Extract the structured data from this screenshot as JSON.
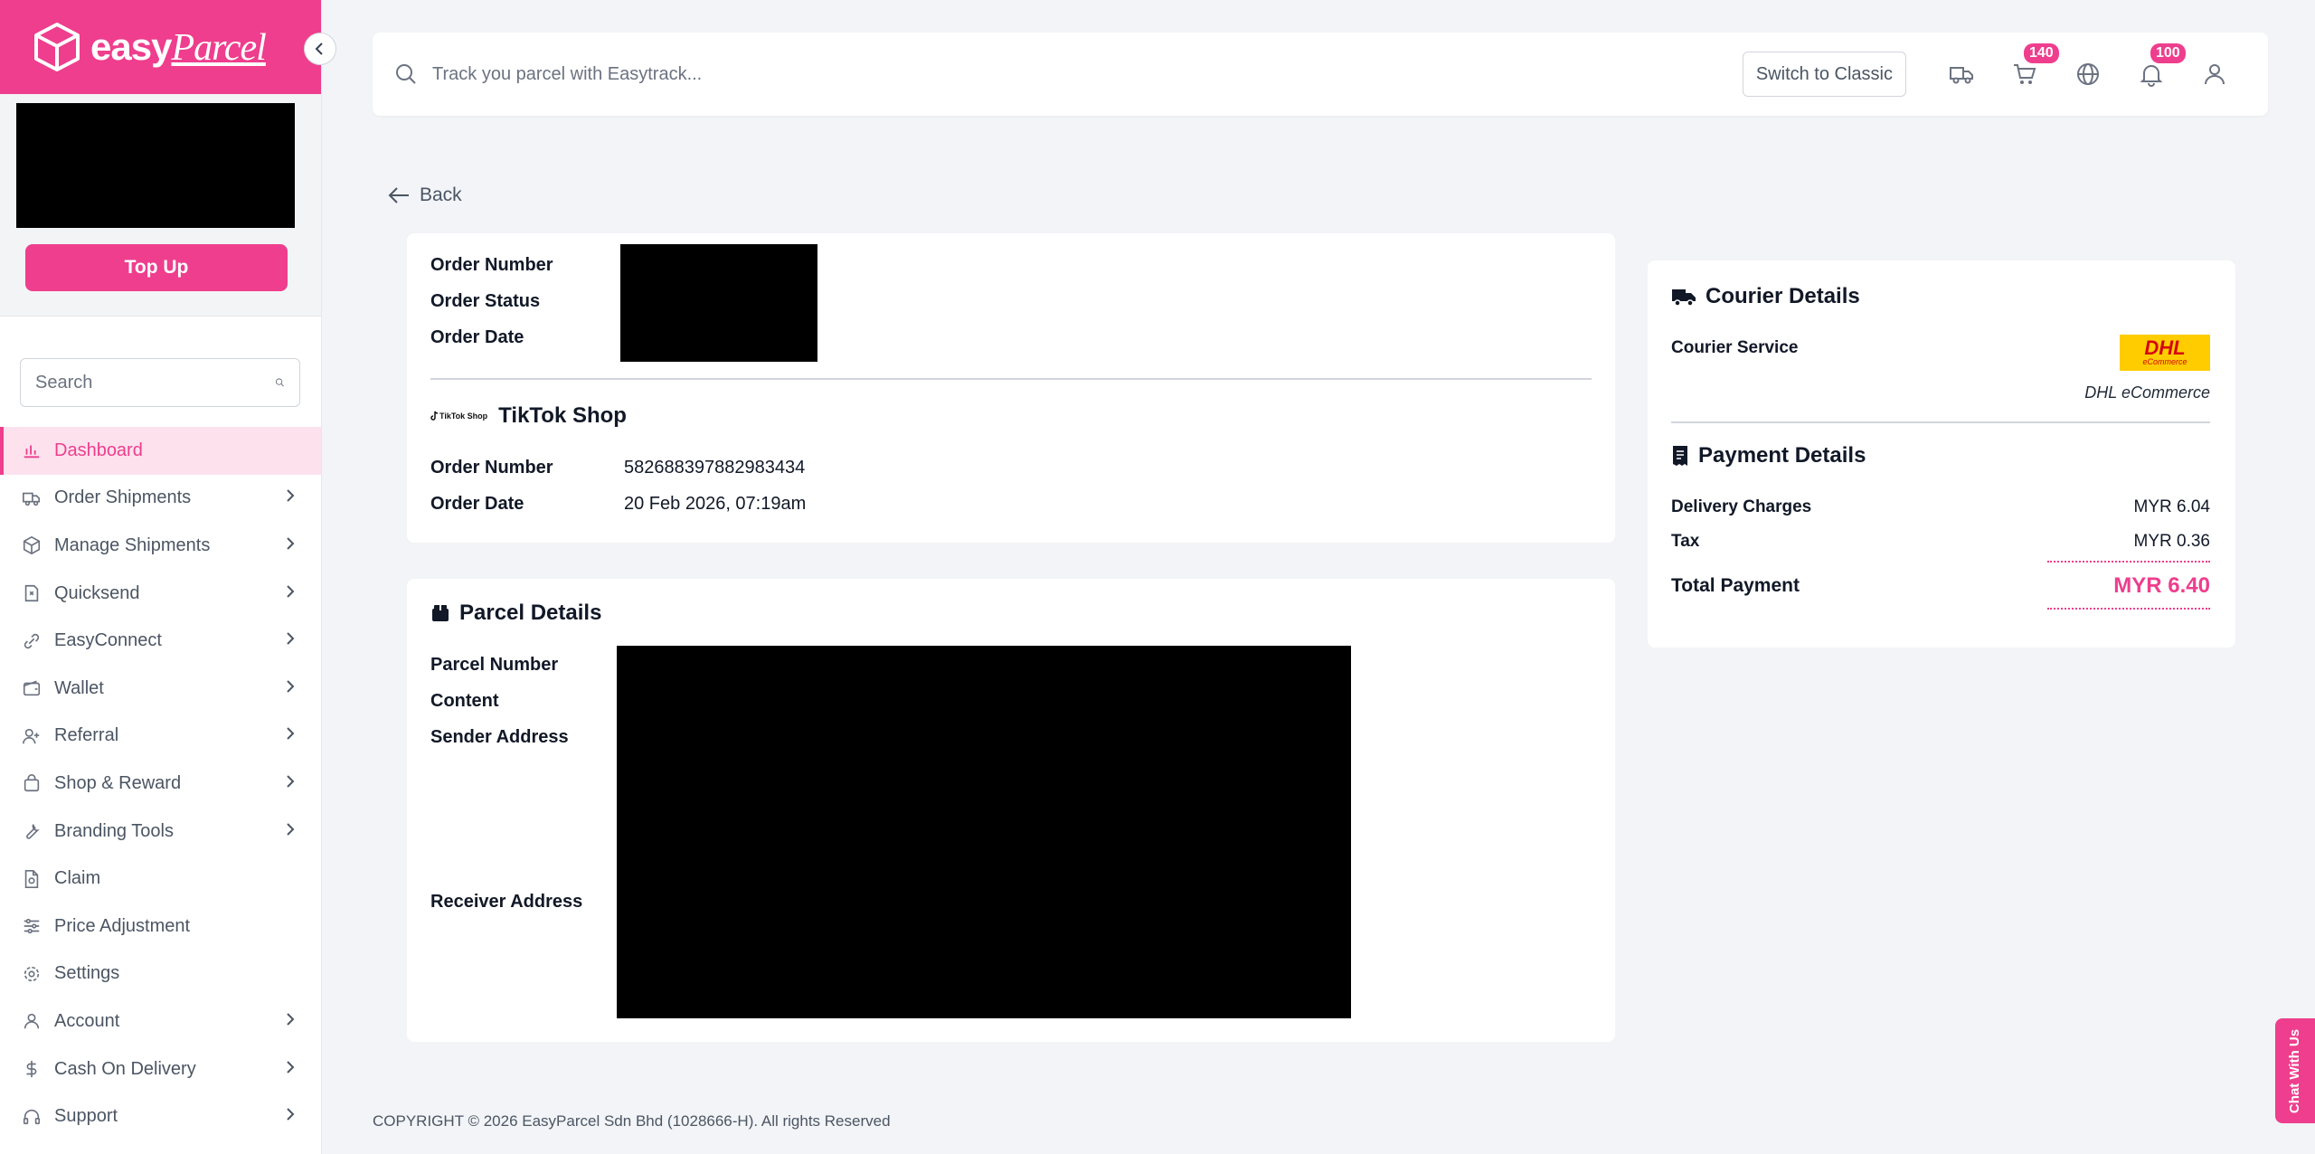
{
  "brand": {
    "logo_word": "easy",
    "logo_script": "Parcel"
  },
  "sidebar": {
    "topup_label": "Top Up",
    "search_placeholder": "Search",
    "items": [
      {
        "label": "Dashboard",
        "icon": "chart-icon",
        "active": true,
        "chevron": false
      },
      {
        "label": "Order Shipments",
        "icon": "truck-icon",
        "chevron": true
      },
      {
        "label": "Manage Shipments",
        "icon": "box-icon",
        "chevron": true
      },
      {
        "label": "Quicksend",
        "icon": "quicksend-icon",
        "chevron": true
      },
      {
        "label": "EasyConnect",
        "icon": "link-icon",
        "chevron": true
      },
      {
        "label": "Wallet",
        "icon": "wallet-icon",
        "chevron": true
      },
      {
        "label": "Referral",
        "icon": "referral-icon",
        "chevron": true
      },
      {
        "label": "Shop & Reward",
        "icon": "bag-icon",
        "chevron": true
      },
      {
        "label": "Branding Tools",
        "icon": "wrench-icon",
        "chevron": true
      },
      {
        "label": "Claim",
        "icon": "document-icon",
        "chevron": false
      },
      {
        "label": "Price Adjustment",
        "icon": "sliders-icon",
        "chevron": false
      },
      {
        "label": "Settings",
        "icon": "gear-icon",
        "chevron": false
      },
      {
        "label": "Account",
        "icon": "user-icon",
        "chevron": true
      },
      {
        "label": "Cash On Delivery",
        "icon": "dollar-icon",
        "chevron": true
      },
      {
        "label": "Support",
        "icon": "headset-icon",
        "chevron": true
      }
    ]
  },
  "topbar": {
    "track_placeholder": "Track you parcel with Easytrack...",
    "switch_label": "Switch to Classic",
    "cart_badge": "140",
    "notification_badge": "100"
  },
  "back_label": "Back",
  "order": {
    "order_number_label": "Order Number",
    "order_status_label": "Order Status",
    "order_date_label": "Order Date",
    "platform_name": "TikTok Shop",
    "platform_logo_text": "TikTok Shop",
    "platform_order_number_label": "Order Number",
    "platform_order_number": "582688397882983434",
    "platform_order_date_label": "Order Date",
    "platform_order_date": "20 Feb 2026, 07:19am"
  },
  "parcel": {
    "title": "Parcel Details",
    "parcel_number_label": "Parcel Number",
    "content_label": "Content",
    "sender_label": "Sender Address",
    "receiver_label": "Receiver Address"
  },
  "courier": {
    "title": "Courier Details",
    "service_label": "Courier Service",
    "service_name": "DHL eCommerce",
    "logo_text": "DHL",
    "logo_sub": "eCommerce"
  },
  "payment": {
    "title": "Payment Details",
    "delivery_label": "Delivery Charges",
    "delivery_value": "MYR 6.04",
    "tax_label": "Tax",
    "tax_value": "MYR 0.36",
    "total_label": "Total Payment",
    "total_value": "MYR 6.40"
  },
  "footer": "COPYRIGHT © 2026 EasyParcel Sdn Bhd (1028666-H). All rights Reserved",
  "chat_label": "Chat With Us",
  "colors": {
    "brand_pink": "#ee3e8d",
    "dhl_yellow": "#ffcc00",
    "dhl_red": "#d40511"
  }
}
